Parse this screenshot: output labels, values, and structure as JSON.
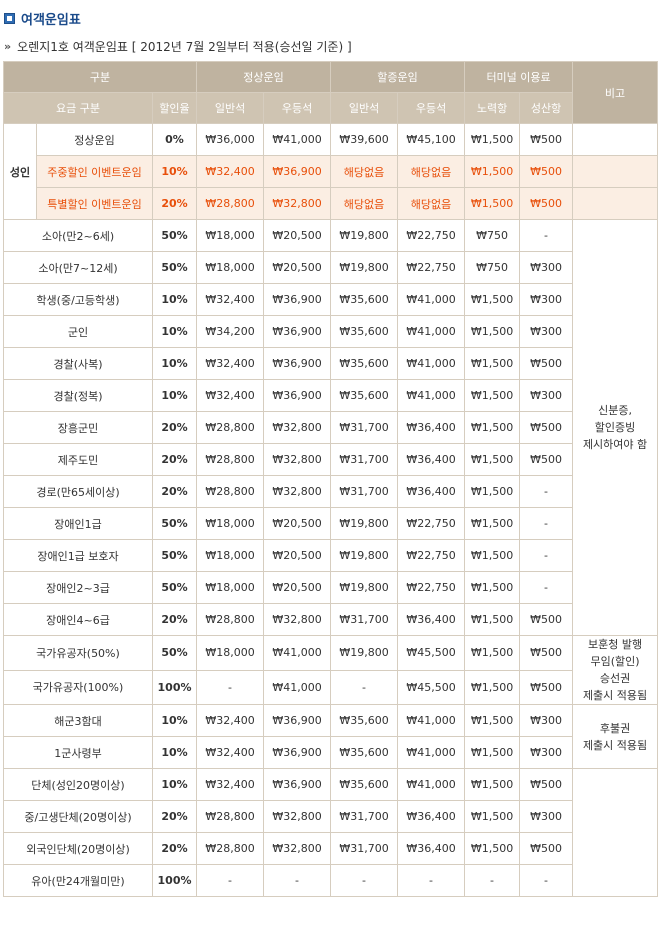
{
  "page": {
    "title": "여객운임표",
    "subtitle": "오렌지1호 여객운임표 [ 2012년 7월 2일부터 적용(승선일 기준) ]"
  },
  "table": {
    "header1": {
      "group": "구분",
      "normal": "정상운임",
      "holiday": "할증운임",
      "terminal": "터미널 이용료",
      "remarks": "비고"
    },
    "header2": {
      "fare_type": "요금 구분",
      "discount": "할인율",
      "normal_general": "일반석",
      "normal_premium": "우등석",
      "holiday_general": "일반석",
      "holiday_premium": "우등석",
      "mokpo": "노력항",
      "seongsan": "성산항"
    },
    "adult_group": "성인",
    "adult_rows": [
      {
        "label": "정상운임",
        "rate": "0%",
        "ng": "₩36,000",
        "np": "₩41,000",
        "hg": "₩39,600",
        "hp": "₩45,100",
        "t1": "₩1,500",
        "t2": "₩500"
      },
      {
        "label": "주중할인 이벤트운임",
        "rate": "10%",
        "ng": "₩32,400",
        "np": "₩36,900",
        "hg": "해당없음",
        "hp": "해당없음",
        "t1": "₩1,500",
        "t2": "₩500"
      },
      {
        "label": "특별할인 이벤트운임",
        "rate": "20%",
        "ng": "₩28,800",
        "np": "₩32,800",
        "hg": "해당없음",
        "hp": "해당없음",
        "t1": "₩1,500",
        "t2": "₩500"
      }
    ],
    "rows": [
      {
        "label": "소아(만2~6세)",
        "rate": "50%",
        "ng": "₩18,000",
        "np": "₩20,500",
        "hg": "₩19,800",
        "hp": "₩22,750",
        "t1": "₩750",
        "t2": "-"
      },
      {
        "label": "소아(만7~12세)",
        "rate": "50%",
        "ng": "₩18,000",
        "np": "₩20,500",
        "hg": "₩19,800",
        "hp": "₩22,750",
        "t1": "₩750",
        "t2": "₩300"
      },
      {
        "label": "학생(중/고등학생)",
        "rate": "10%",
        "ng": "₩32,400",
        "np": "₩36,900",
        "hg": "₩35,600",
        "hp": "₩41,000",
        "t1": "₩1,500",
        "t2": "₩300"
      },
      {
        "label": "군인",
        "rate": "10%",
        "ng": "₩34,200",
        "np": "₩36,900",
        "hg": "₩35,600",
        "hp": "₩41,000",
        "t1": "₩1,500",
        "t2": "₩300"
      },
      {
        "label": "경찰(사복)",
        "rate": "10%",
        "ng": "₩32,400",
        "np": "₩36,900",
        "hg": "₩35,600",
        "hp": "₩41,000",
        "t1": "₩1,500",
        "t2": "₩500"
      },
      {
        "label": "경찰(정복)",
        "rate": "10%",
        "ng": "₩32,400",
        "np": "₩36,900",
        "hg": "₩35,600",
        "hp": "₩41,000",
        "t1": "₩1,500",
        "t2": "₩300"
      },
      {
        "label": "장흥군민",
        "rate": "20%",
        "ng": "₩28,800",
        "np": "₩32,800",
        "hg": "₩31,700",
        "hp": "₩36,400",
        "t1": "₩1,500",
        "t2": "₩500"
      },
      {
        "label": "제주도민",
        "rate": "20%",
        "ng": "₩28,800",
        "np": "₩32,800",
        "hg": "₩31,700",
        "hp": "₩36,400",
        "t1": "₩1,500",
        "t2": "₩500"
      },
      {
        "label": "경로(만65세이상)",
        "rate": "20%",
        "ng": "₩28,800",
        "np": "₩32,800",
        "hg": "₩31,700",
        "hp": "₩36,400",
        "t1": "₩1,500",
        "t2": "-"
      },
      {
        "label": "장애인1급",
        "rate": "50%",
        "ng": "₩18,000",
        "np": "₩20,500",
        "hg": "₩19,800",
        "hp": "₩22,750",
        "t1": "₩1,500",
        "t2": "-"
      },
      {
        "label": "장애인1급 보호자",
        "rate": "50%",
        "ng": "₩18,000",
        "np": "₩20,500",
        "hg": "₩19,800",
        "hp": "₩22,750",
        "t1": "₩1,500",
        "t2": "-"
      },
      {
        "label": "장애인2~3급",
        "rate": "50%",
        "ng": "₩18,000",
        "np": "₩20,500",
        "hg": "₩19,800",
        "hp": "₩22,750",
        "t1": "₩1,500",
        "t2": "-"
      },
      {
        "label": "장애인4~6급",
        "rate": "20%",
        "ng": "₩28,800",
        "np": "₩32,800",
        "hg": "₩31,700",
        "hp": "₩36,400",
        "t1": "₩1,500",
        "t2": "₩500"
      },
      {
        "label": "국가유공자(50%)",
        "rate": "50%",
        "ng": "₩18,000",
        "np": "₩41,000",
        "hg": "₩19,800",
        "hp": "₩45,500",
        "t1": "₩1,500",
        "t2": "₩500"
      },
      {
        "label": "국가유공자(100%)",
        "rate": "100%",
        "ng": "-",
        "np": "₩41,000",
        "hg": "-",
        "hp": "₩45,500",
        "t1": "₩1,500",
        "t2": "₩500"
      },
      {
        "label": "해군3함대",
        "rate": "10%",
        "ng": "₩32,400",
        "np": "₩36,900",
        "hg": "₩35,600",
        "hp": "₩41,000",
        "t1": "₩1,500",
        "t2": "₩300"
      },
      {
        "label": "1군사령부",
        "rate": "10%",
        "ng": "₩32,400",
        "np": "₩36,900",
        "hg": "₩35,600",
        "hp": "₩41,000",
        "t1": "₩1,500",
        "t2": "₩300"
      },
      {
        "label": "단체(성인20명이상)",
        "rate": "10%",
        "ng": "₩32,400",
        "np": "₩36,900",
        "hg": "₩35,600",
        "hp": "₩41,000",
        "t1": "₩1,500",
        "t2": "₩500"
      },
      {
        "label": "중/고생단체(20명이상)",
        "rate": "20%",
        "ng": "₩28,800",
        "np": "₩32,800",
        "hg": "₩31,700",
        "hp": "₩36,400",
        "t1": "₩1,500",
        "t2": "₩300"
      },
      {
        "label": "외국인단체(20명이상)",
        "rate": "20%",
        "ng": "₩28,800",
        "np": "₩32,800",
        "hg": "₩31,700",
        "hp": "₩36,400",
        "t1": "₩1,500",
        "t2": "₩500"
      },
      {
        "label": "유아(만24개월미만)",
        "rate": "100%",
        "ng": "-",
        "np": "-",
        "hg": "-",
        "hp": "-",
        "t1": "-",
        "t2": "-"
      }
    ],
    "notes": {
      "id_required": [
        "신분증,",
        "할인증빙",
        "제시하여야 함"
      ],
      "veterans": [
        "보훈청 발행",
        "무임(할인)",
        "승선권",
        "제출시 적용됨"
      ],
      "military": [
        "후불권",
        "제출시 적용됨"
      ]
    }
  }
}
